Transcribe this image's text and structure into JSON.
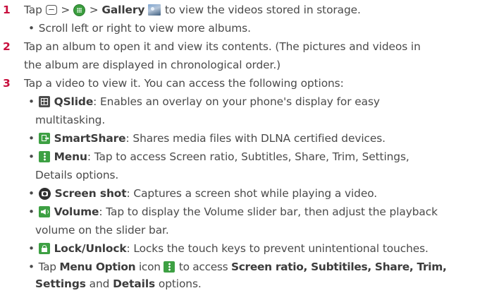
{
  "steps": [
    {
      "number": "1",
      "tap": "Tap",
      "gt1": ">",
      "gt2": ">",
      "gallery": "Gallery",
      "rest": "to view the videos stored in storage.",
      "bullet": "Scroll left or right to view more albums."
    },
    {
      "number": "2",
      "line1": "Tap an album to open it and view its contents. (The pictures and videos in",
      "line2": "the album are displayed in chronological order.)"
    },
    {
      "number": "3",
      "line1": "Tap a video to view it. You can access the following options:"
    }
  ],
  "options": {
    "qslide": {
      "title": "QSlide",
      "line1": ": Enables an overlay on your phone's display for easy",
      "line2": "multitasking."
    },
    "smartshare": {
      "title": "SmartShare",
      "line1": ": Shares media files with DLNA certified devices."
    },
    "menu": {
      "title": "Menu",
      "line1": ": Tap to access Screen ratio, Subtitles, Share, Trim, Settings,",
      "line2": "Details options."
    },
    "screenshot": {
      "title": "Screen shot",
      "line1": ": Captures a screen shot while playing a video."
    },
    "volume": {
      "title": "Volume",
      "line1": ": Tap to display the Volume slider bar, then adjust the playback",
      "line2": "volume on the slider bar."
    },
    "lock": {
      "title": "Lock/Unlock",
      "line1": ": Locks the touch keys to prevent unintentional touches."
    },
    "menu_option": {
      "tap": "Tap",
      "title": "Menu Option",
      "icon_word": "icon",
      "access": "to access",
      "bold1": "Screen ratio, Subtitiles, Share, Trim,",
      "bold2": "Settings",
      "and1": "and",
      "bold3": "Details",
      "end": "options."
    }
  },
  "bullet_char": "•",
  "icons": [
    "home-key-icon",
    "apps-icon",
    "gallery-icon",
    "qslide-icon",
    "smartshare-icon",
    "menu-icon",
    "screen-shot-icon",
    "volume-icon",
    "lock-icon",
    "menu-option-icon"
  ],
  "colors": {
    "step_number": "#c8103e",
    "text": "#4a4a4a",
    "icon_green": "#3da043"
  }
}
